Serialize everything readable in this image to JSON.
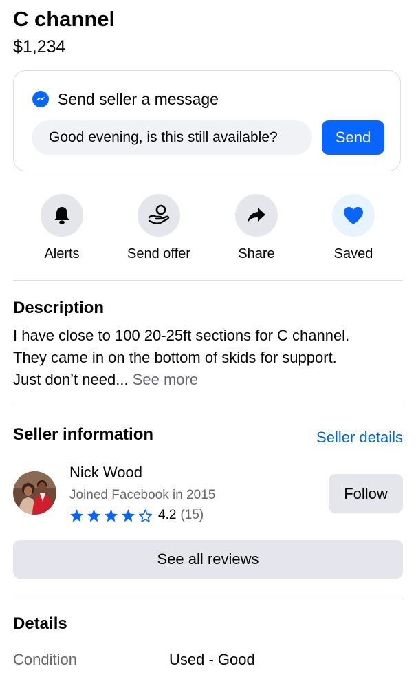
{
  "listing": {
    "title": "C channel",
    "price": "$1,234"
  },
  "message_card": {
    "heading": "Send seller a message",
    "input_value": "Good evening, is this still available?",
    "send_label": "Send"
  },
  "actions": [
    {
      "label": "Alerts",
      "icon": "bell-icon"
    },
    {
      "label": "Send offer",
      "icon": "offer-icon"
    },
    {
      "label": "Share",
      "icon": "share-icon"
    },
    {
      "label": "Saved",
      "icon": "heart-icon",
      "active": true
    }
  ],
  "description": {
    "heading": "Description",
    "line1": "I have close to 100 20-25ft sections for C channel.",
    "line2": "They came in on the bottom of skids for support.",
    "line3": "Just don’t need...",
    "see_more": "See more"
  },
  "seller": {
    "heading": "Seller information",
    "details_link": "Seller details",
    "name": "Nick Wood",
    "joined": "Joined Facebook in 2015",
    "rating": 4.2,
    "rating_text": "4.2",
    "review_count": "(15)",
    "stars_filled": 4,
    "stars_total": 5,
    "follow_label": "Follow",
    "reviews_button": "See all reviews"
  },
  "details": {
    "heading": "Details",
    "condition_label": "Condition",
    "condition_value": "Used - Good"
  },
  "colors": {
    "brand_blue": "#0866ff",
    "link_blue": "#0064d1",
    "gray_button": "#e4e6eb",
    "secondary_text": "#65676b"
  }
}
